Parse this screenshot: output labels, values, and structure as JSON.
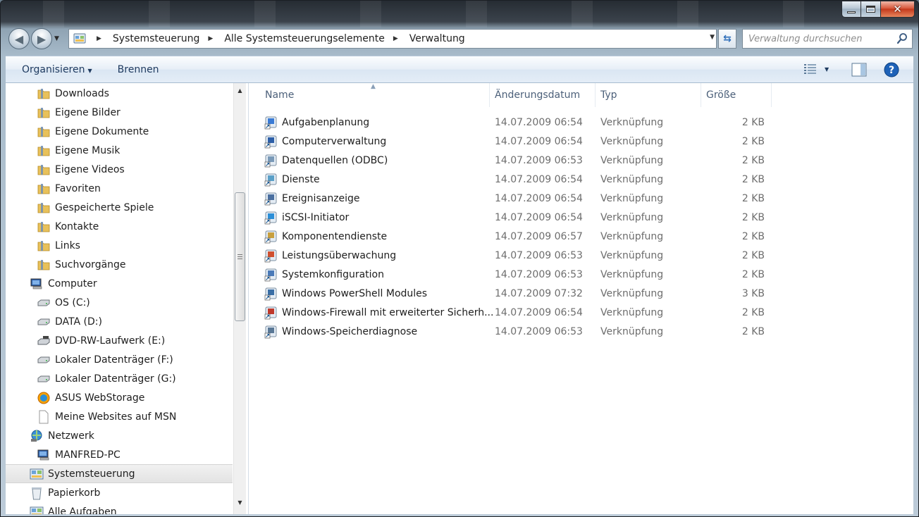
{
  "window": {
    "caption": {
      "minimize": "",
      "maximize": "",
      "close": "✕"
    }
  },
  "nav": {
    "back": "◀",
    "forward": "▶",
    "history": "▼"
  },
  "address": {
    "breadcrumbs": [
      "Systemsteuerung",
      "Alle Systemsteuerungselemente",
      "Verwaltung"
    ],
    "separator": "▶",
    "dropdown": "▼",
    "refresh": "⇆"
  },
  "search": {
    "placeholder": "Verwaltung durchsuchen"
  },
  "commandbar": {
    "organize": "Organisieren",
    "organize_dd": "▼",
    "burn": "Brennen",
    "view_dd": "▼"
  },
  "navpane": {
    "items": [
      {
        "label": "Downloads",
        "icon": "folder-icon"
      },
      {
        "label": "Eigene Bilder",
        "icon": "folder-icon"
      },
      {
        "label": "Eigene Dokumente",
        "icon": "folder-icon"
      },
      {
        "label": "Eigene Musik",
        "icon": "folder-icon"
      },
      {
        "label": "Eigene Videos",
        "icon": "folder-icon"
      },
      {
        "label": "Favoriten",
        "icon": "folder-icon"
      },
      {
        "label": "Gespeicherte Spiele",
        "icon": "folder-icon"
      },
      {
        "label": "Kontakte",
        "icon": "folder-icon"
      },
      {
        "label": "Links",
        "icon": "folder-icon"
      },
      {
        "label": "Suchvorgänge",
        "icon": "folder-icon"
      },
      {
        "label": "Computer",
        "icon": "computer-icon"
      },
      {
        "label": "OS (C:)",
        "icon": "drive-icon"
      },
      {
        "label": "DATA (D:)",
        "icon": "drive-icon"
      },
      {
        "label": "DVD-RW-Laufwerk (E:)",
        "icon": "dvd-drive-icon"
      },
      {
        "label": "Lokaler Datenträger (F:)",
        "icon": "drive-icon"
      },
      {
        "label": "Lokaler Datenträger (G:)",
        "icon": "drive-icon"
      },
      {
        "label": "ASUS WebStorage",
        "icon": "webstorage-icon"
      },
      {
        "label": "Meine Websites auf MSN",
        "icon": "document-icon"
      },
      {
        "label": "Netzwerk",
        "icon": "network-icon"
      },
      {
        "label": "MANFRED-PC",
        "icon": "computer-icon"
      },
      {
        "label": "Systemsteuerung",
        "icon": "control-panel-icon"
      },
      {
        "label": "Papierkorb",
        "icon": "recycle-bin-icon"
      },
      {
        "label": "Alle Aufgaben",
        "icon": "control-panel-icon"
      }
    ],
    "scroll": {
      "up": "▲",
      "down": "▼"
    }
  },
  "filelist": {
    "columns": [
      "Name",
      "Änderungsdatum",
      "Typ",
      "Größe"
    ],
    "sort_indicator": "▲",
    "rows": [
      {
        "name": "Aufgabenplanung",
        "date": "14.07.2009 06:54",
        "type": "Verknüpfung",
        "size": "2 KB"
      },
      {
        "name": "Computerverwaltung",
        "date": "14.07.2009 06:54",
        "type": "Verknüpfung",
        "size": "2 KB"
      },
      {
        "name": "Datenquellen (ODBC)",
        "date": "14.07.2009 06:53",
        "type": "Verknüpfung",
        "size": "2 KB"
      },
      {
        "name": "Dienste",
        "date": "14.07.2009 06:54",
        "type": "Verknüpfung",
        "size": "2 KB"
      },
      {
        "name": "Ereignisanzeige",
        "date": "14.07.2009 06:54",
        "type": "Verknüpfung",
        "size": "2 KB"
      },
      {
        "name": "iSCSI-Initiator",
        "date": "14.07.2009 06:54",
        "type": "Verknüpfung",
        "size": "2 KB"
      },
      {
        "name": "Komponentendienste",
        "date": "14.07.2009 06:57",
        "type": "Verknüpfung",
        "size": "2 KB"
      },
      {
        "name": "Leistungsüberwachung",
        "date": "14.07.2009 06:53",
        "type": "Verknüpfung",
        "size": "2 KB"
      },
      {
        "name": "Systemkonfiguration",
        "date": "14.07.2009 06:53",
        "type": "Verknüpfung",
        "size": "2 KB"
      },
      {
        "name": "Windows PowerShell Modules",
        "date": "14.07.2009 07:32",
        "type": "Verknüpfung",
        "size": "3 KB"
      },
      {
        "name": "Windows-Firewall mit erweiterter Sicherh...",
        "date": "14.07.2009 06:54",
        "type": "Verknüpfung",
        "size": "2 KB"
      },
      {
        "name": "Windows-Speicherdiagnose",
        "date": "14.07.2009 06:53",
        "type": "Verknüpfung",
        "size": "2 KB"
      }
    ]
  },
  "colors": {
    "folder": "#e8c15a",
    "header_text": "#4c607a",
    "secondary_text": "#6d6d6d",
    "close_button": "#c4391c"
  }
}
